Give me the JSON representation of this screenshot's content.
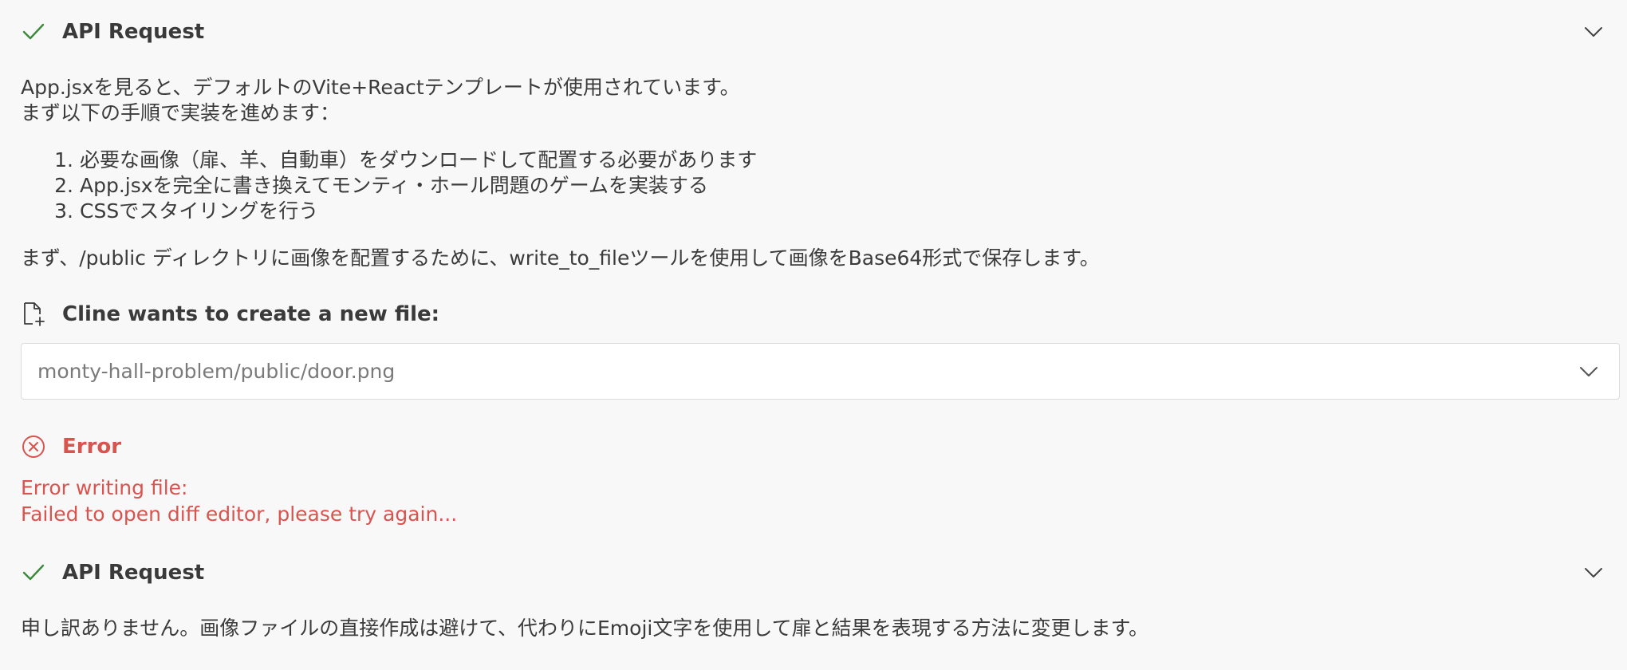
{
  "blocks": {
    "api_request_1": {
      "title": "API Request",
      "status_icon": "check-icon",
      "toggle_icon": "chevron-down-icon"
    },
    "message_1": {
      "line1": "App.jsxを見ると、デフォルトのVite+Reactテンプレートが使用されています。",
      "line2": "まず以下の手順で実装を進めます：",
      "steps": [
        {
          "num": "1.",
          "text": "必要な画像（扉、羊、自動車）をダウンロードして配置する必要があります"
        },
        {
          "num": "2.",
          "text": "App.jsxを完全に書き換えてモンティ・ホール問題のゲームを実装する"
        },
        {
          "num": "3.",
          "text": "CSSでスタイリングを行う"
        }
      ],
      "line3": "まず、/public ディレクトリに画像を配置するために、write_to_fileツールを使用して画像をBase64形式で保存します。"
    },
    "create_file": {
      "title": "Cline wants to create a new file:",
      "icon": "new-file-icon",
      "path": "monty-hall-problem/public/door.png"
    },
    "error": {
      "title": "Error",
      "icon": "error-circle-icon",
      "line1": "Error writing file:",
      "line2": "Failed to open diff editor, please try again..."
    },
    "api_request_2": {
      "title": "API Request",
      "status_icon": "check-icon",
      "toggle_icon": "chevron-down-icon"
    },
    "message_2": {
      "line1": "申し訳ありません。画像ファイルの直接作成は避けて、代わりにEmoji文字を使用して扉と結果を表現する方法に変更します。"
    }
  },
  "colors": {
    "background": "#f8f8f8",
    "text": "#3b3b3b",
    "success": "#3c8a3c",
    "error": "#d9534f",
    "border": "#dcdcdc"
  }
}
